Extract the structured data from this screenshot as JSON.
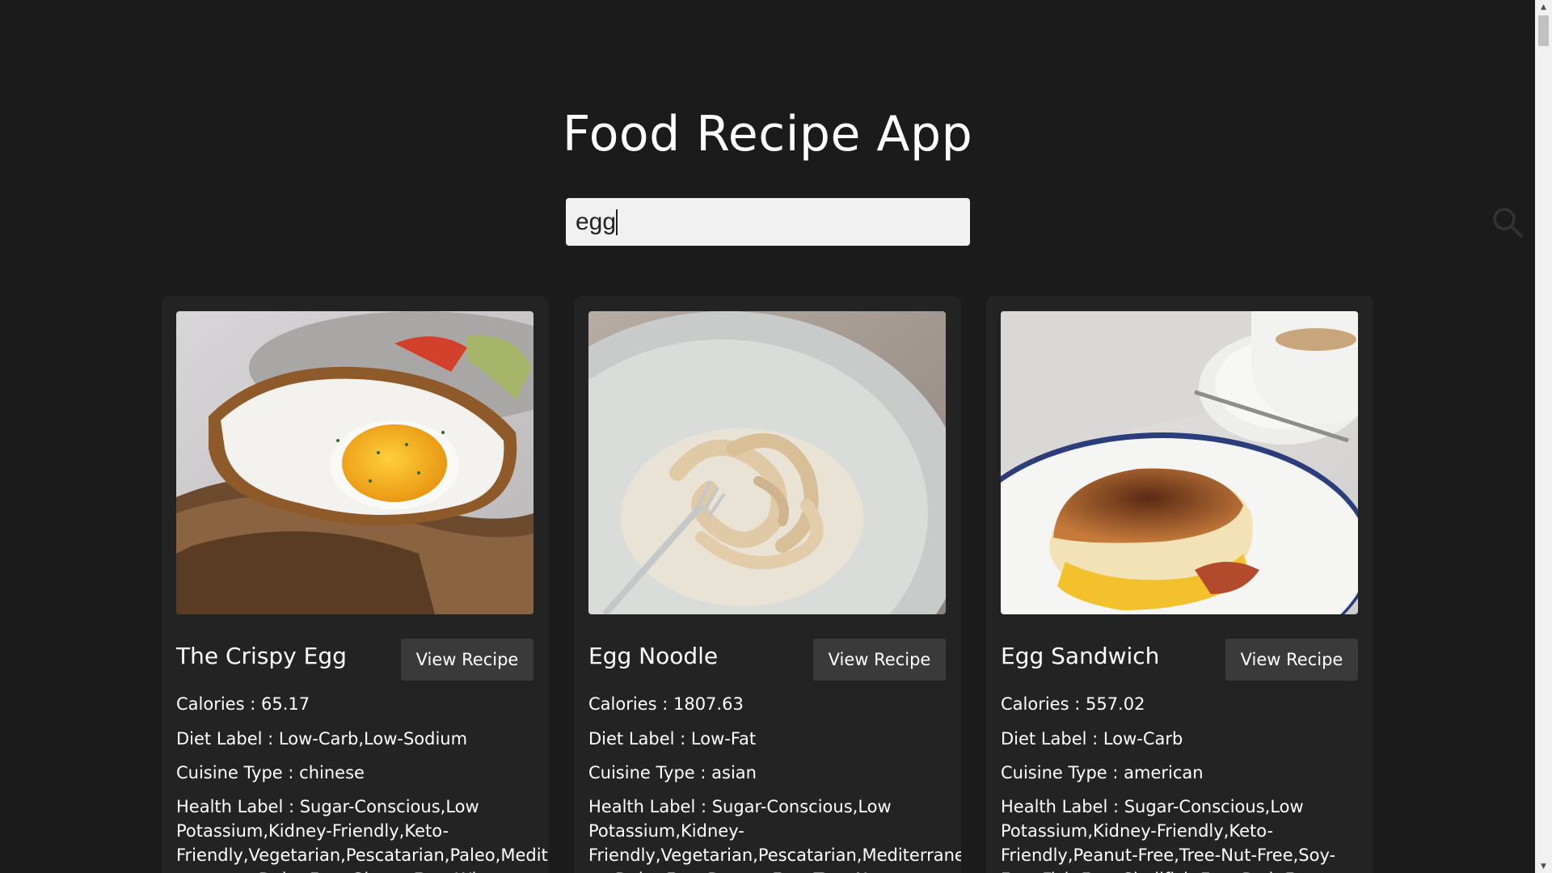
{
  "app": {
    "title": "Food Recipe App"
  },
  "search": {
    "value": "egg",
    "icon": "search-icon"
  },
  "recipes": [
    {
      "title": "The Crispy Egg",
      "button_label": "View Recipe",
      "calories": "Calories : 65.17",
      "diet": "Diet Label : Low-Carb,Low-Sodium",
      "cuisine": "Cuisine Type : chinese",
      "health": "Health Label : Sugar-Conscious,Low Potassium,Kidney-Friendly,Keto-Friendly,Vegetarian,Pescatarian,Paleo,Mediterranean,Dairy-Free,Gluten-Free,Wheat-Free,Peanut-Free",
      "image": "fried-egg-on-toast"
    },
    {
      "title": "Egg Noodle",
      "button_label": "View Recipe",
      "calories": "Calories : 1807.63",
      "diet": "Diet Label : Low-Fat",
      "cuisine": "Cuisine Type : asian",
      "health": "Health Label : Sugar-Conscious,Low Potassium,Kidney-Friendly,Vegetarian,Pescatarian,Mediterranean,Dairy-Free,Peanut-Free,Tree-Nut-Free,Soy-Free",
      "image": "egg-noodles-plate"
    },
    {
      "title": "Egg Sandwich",
      "button_label": "View Recipe",
      "calories": "Calories : 557.02",
      "diet": "Diet Label : Low-Carb",
      "cuisine": "Cuisine Type : american",
      "health": "Health Label : Sugar-Conscious,Low Potassium,Kidney-Friendly,Keto-Friendly,Peanut-Free,Tree-Nut-Free,Soy-Free,Fish-Free,Shellfish-Free,Pork-Free",
      "image": "egg-sandwich-coffee"
    }
  ],
  "scrollbar": {
    "up_icon": "scroll-up-arrow-icon",
    "down_icon": "scroll-down-arrow-icon"
  }
}
